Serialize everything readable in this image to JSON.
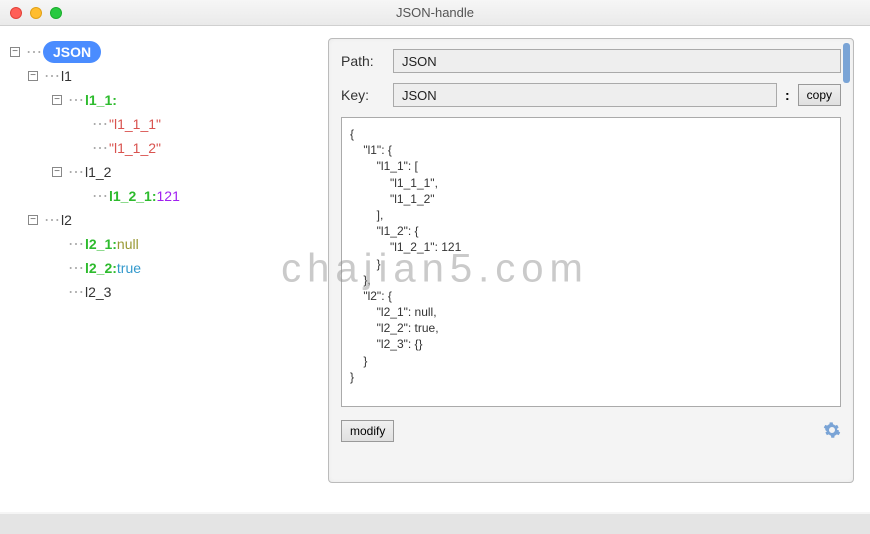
{
  "window": {
    "title": "JSON-handle"
  },
  "tree": {
    "root": "JSON",
    "l1": "l1",
    "l1_1": "l1_1",
    "l1_1_colon": " :",
    "l1_1_1": "\"l1_1_1\"",
    "l1_1_2": "\"l1_1_2\"",
    "l1_2": "l1_2",
    "l1_2_1": "l1_2_1",
    "l1_2_1_colon": " : ",
    "l1_2_1_val": "121",
    "l2": "l2",
    "l2_1": "l2_1",
    "l2_1_colon": " : ",
    "l2_1_val": "null",
    "l2_2": "l2_2",
    "l2_2_colon": " : ",
    "l2_2_val": "true",
    "l2_3": "l2_3"
  },
  "panel": {
    "path_label": "Path:",
    "path_value": "JSON",
    "key_label": "Key:",
    "key_value": "JSON",
    "colon": ":",
    "copy_btn": "copy",
    "modify_btn": "modify",
    "json_text": "{\n    \"l1\": {\n        \"l1_1\": [\n            \"l1_1_1\",\n            \"l1_1_2\"\n        ],\n        \"l1_2\": {\n            \"l1_2_1\": 121\n        }\n    },\n    \"l2\": {\n        \"l2_1\": null,\n        \"l2_2\": true,\n        \"l2_3\": {}\n    }\n}"
  },
  "watermark": "chajian5.com",
  "toggle": {
    "minus": "−",
    "plus": "+"
  },
  "chart_data": {
    "type": "table",
    "title": "JSON tree structure",
    "data": {
      "l1": {
        "l1_1": [
          "l1_1_1",
          "l1_1_2"
        ],
        "l1_2": {
          "l1_2_1": 121
        }
      },
      "l2": {
        "l2_1": null,
        "l2_2": true,
        "l2_3": {}
      }
    }
  }
}
